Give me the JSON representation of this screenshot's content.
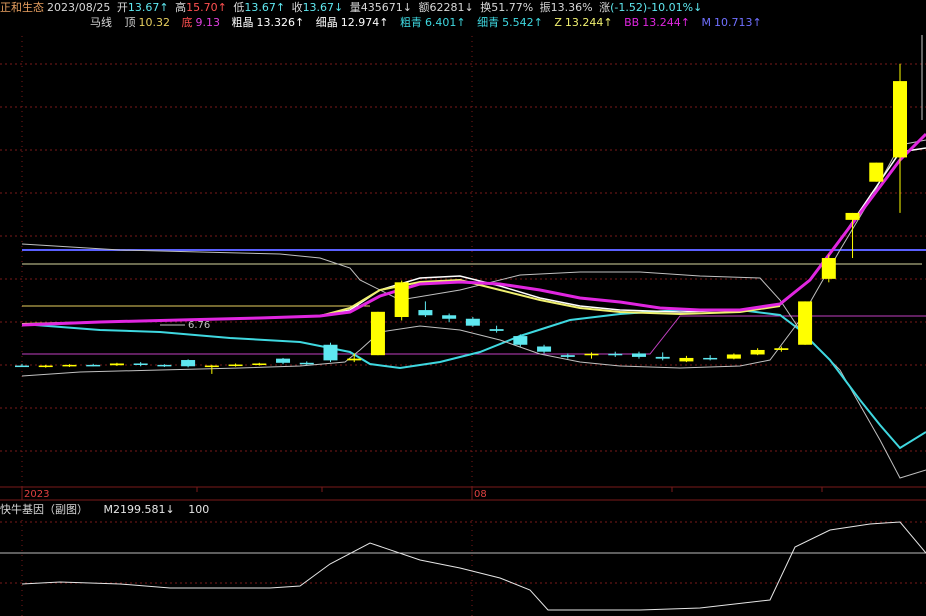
{
  "header": {
    "stock_name": "正和生态",
    "date": "2023/08/25",
    "open_label": "开",
    "open": "13.67↑",
    "high_label": "高",
    "high": "15.70↑",
    "low_label": "低",
    "low": "13.67↑",
    "close_label": "收",
    "close": "13.67↓",
    "volume_label": "量",
    "volume": "435671↓",
    "amount_label": "额",
    "amount": "62281↓",
    "turnover_label": "换",
    "turnover": "51.77%",
    "amplitude_label": "振",
    "amplitude": "13.36%",
    "change_label": "涨",
    "change": "(-1.52)-10.01%↓"
  },
  "indicator": {
    "name": "马线",
    "top_label": "顶",
    "top_value": "10.32",
    "bottom_label": "底",
    "bottom_value": "9.13",
    "cu_jing_label": "粗晶",
    "cu_jing_value": "13.326↑",
    "xi_jing_label": "细晶",
    "xi_jing_value": "12.974↑",
    "cu_qing_label": "粗青",
    "cu_qing_value": "6.401↑",
    "xi_qing_label": "细青",
    "xi_qing_value": "5.542↑",
    "z_label": "Z",
    "z_value": "13.244↑",
    "bb_label": "BB",
    "bb_value": "13.244↑",
    "m_label": "M",
    "m_value": "10.713↑"
  },
  "sub_panel": {
    "name": "快牛基因（副图）",
    "m21_label": "M21",
    "m21_value": "99.581↓",
    "level": "100"
  },
  "axis": {
    "year_label": "2023",
    "month_label": "08"
  },
  "annotations": {
    "low_price": "6.76"
  },
  "colors": {
    "bg": "#000000",
    "grid": "#7a1a1a",
    "up": "#ffff00",
    "down": "#5fe8f0",
    "bb": "#e026e0",
    "m": "#5b5bff",
    "white_line": "#ffffff",
    "cyan_line": "#3fd8e0",
    "yellow_line": "#f0f070",
    "purple_line": "#c030c0",
    "hline_top": "#5a60ff",
    "hline_mid": "#d8d8a0",
    "hline_pink": "#c040c0"
  },
  "chart_data": {
    "type": "candlestick",
    "candles": [
      {
        "o": 7.0,
        "h": 7.05,
        "l": 6.96,
        "c": 6.98
      },
      {
        "o": 6.98,
        "h": 7.02,
        "l": 6.94,
        "c": 7.0
      },
      {
        "o": 7.0,
        "h": 7.04,
        "l": 6.96,
        "c": 7.02
      },
      {
        "o": 7.02,
        "h": 7.05,
        "l": 6.98,
        "c": 7.01
      },
      {
        "o": 7.01,
        "h": 7.08,
        "l": 6.99,
        "c": 7.06
      },
      {
        "o": 7.06,
        "h": 7.1,
        "l": 6.98,
        "c": 7.02
      },
      {
        "o": 7.02,
        "h": 7.04,
        "l": 6.96,
        "c": 7.0
      },
      {
        "o": 7.16,
        "h": 7.18,
        "l": 6.95,
        "c": 6.98
      },
      {
        "o": 6.98,
        "h": 7.02,
        "l": 6.76,
        "c": 7.0
      },
      {
        "o": 7.0,
        "h": 7.06,
        "l": 6.97,
        "c": 7.03
      },
      {
        "o": 7.03,
        "h": 7.08,
        "l": 7.0,
        "c": 7.06
      },
      {
        "o": 7.2,
        "h": 7.22,
        "l": 7.04,
        "c": 7.08
      },
      {
        "o": 7.08,
        "h": 7.12,
        "l": 7.02,
        "c": 7.05
      },
      {
        "o": 7.6,
        "h": 7.66,
        "l": 7.1,
        "c": 7.15
      },
      {
        "o": 7.15,
        "h": 7.35,
        "l": 7.1,
        "c": 7.2
      },
      {
        "o": 7.3,
        "h": 8.55,
        "l": 7.3,
        "c": 8.55
      },
      {
        "o": 8.4,
        "h": 9.45,
        "l": 8.3,
        "c": 9.4
      },
      {
        "o": 8.6,
        "h": 8.85,
        "l": 8.4,
        "c": 8.45
      },
      {
        "o": 8.45,
        "h": 8.5,
        "l": 8.25,
        "c": 8.35
      },
      {
        "o": 8.35,
        "h": 8.4,
        "l": 8.12,
        "c": 8.15
      },
      {
        "o": 8.05,
        "h": 8.15,
        "l": 7.95,
        "c": 8.0
      },
      {
        "o": 7.85,
        "h": 7.9,
        "l": 7.55,
        "c": 7.6
      },
      {
        "o": 7.55,
        "h": 7.6,
        "l": 7.35,
        "c": 7.4
      },
      {
        "o": 7.3,
        "h": 7.35,
        "l": 7.2,
        "c": 7.25
      },
      {
        "o": 7.3,
        "h": 7.38,
        "l": 7.2,
        "c": 7.34
      },
      {
        "o": 7.34,
        "h": 7.4,
        "l": 7.25,
        "c": 7.32
      },
      {
        "o": 7.35,
        "h": 7.4,
        "l": 7.2,
        "c": 7.25
      },
      {
        "o": 7.25,
        "h": 7.38,
        "l": 7.15,
        "c": 7.2
      },
      {
        "o": 7.12,
        "h": 7.28,
        "l": 7.1,
        "c": 7.22
      },
      {
        "o": 7.22,
        "h": 7.3,
        "l": 7.15,
        "c": 7.2
      },
      {
        "o": 7.2,
        "h": 7.35,
        "l": 7.18,
        "c": 7.32
      },
      {
        "o": 7.32,
        "h": 7.5,
        "l": 7.3,
        "c": 7.45
      },
      {
        "o": 7.45,
        "h": 7.55,
        "l": 7.4,
        "c": 7.5
      },
      {
        "o": 7.6,
        "h": 8.85,
        "l": 7.6,
        "c": 8.85
      },
      {
        "o": 9.5,
        "h": 10.2,
        "l": 9.4,
        "c": 10.1
      },
      {
        "o": 11.2,
        "h": 11.4,
        "l": 10.1,
        "c": 11.4
      },
      {
        "o": 12.3,
        "h": 12.85,
        "l": 12.3,
        "c": 12.85
      },
      {
        "o": 13.0,
        "h": 15.7,
        "l": 11.4,
        "c": 15.2
      }
    ],
    "ylim": [
      3.5,
      16.5
    ]
  }
}
